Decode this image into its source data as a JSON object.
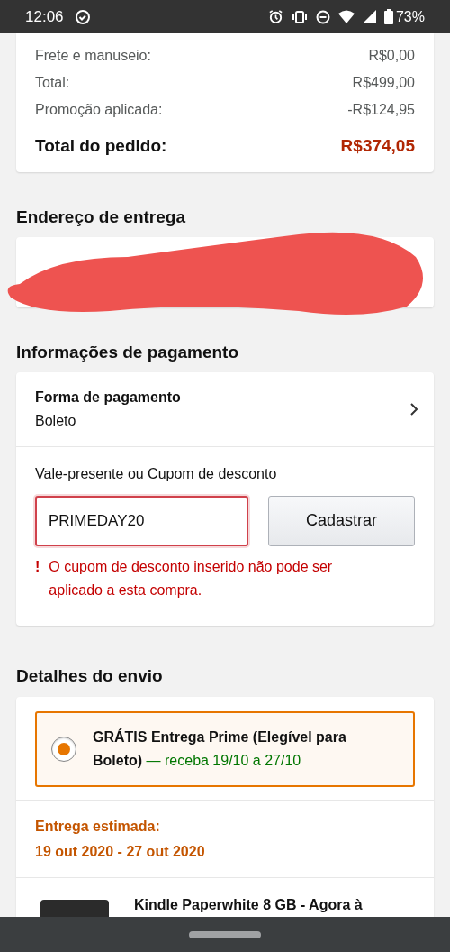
{
  "status_bar": {
    "time": "12:06",
    "battery": "73%"
  },
  "order_summary": {
    "rows": [
      {
        "label": "Frete e manuseio:",
        "value": "R$0,00"
      },
      {
        "label": "Total:",
        "value": "R$499,00"
      },
      {
        "label": "Promoção aplicada:",
        "value": "-R$124,95"
      }
    ],
    "total": {
      "label": "Total do pedido:",
      "value": "R$374,05"
    }
  },
  "shipping_address": {
    "heading": "Endereço de entrega"
  },
  "payment": {
    "heading": "Informações de pagamento",
    "method_label": "Forma de pagamento",
    "method_value": "Boleto",
    "coupon_label": "Vale-presente ou Cupom de desconto",
    "coupon_value": "PRIMEDAY20",
    "button": "Cadastrar",
    "error_icon": "!",
    "error": "O cupom de desconto inserido não pode ser aplicado a esta compra."
  },
  "shipping": {
    "heading": "Detalhes do envio",
    "options": [
      {
        "selected": true,
        "title": "GRÁTIS Entrega Prime (Elegível para Boleto)",
        "eta": "— receba 19/10 a 27/10"
      }
    ],
    "estimated_label": "Entrega estimada:",
    "estimated_dates": "19 out 2020 - 27 out 2020",
    "items": [
      {
        "title": "Kindle Paperwhite 8 GB - Agora à"
      }
    ]
  }
}
